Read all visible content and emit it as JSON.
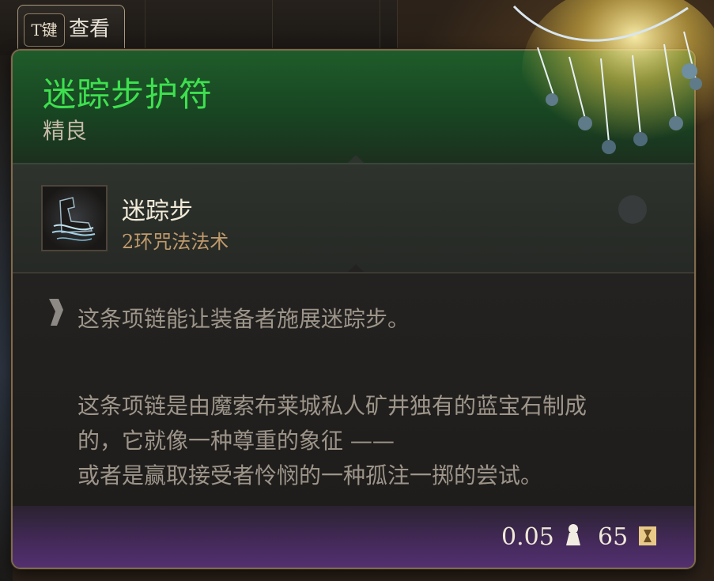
{
  "key_hint": {
    "key": "T键",
    "action": "查看"
  },
  "item": {
    "name": "迷踪步护符",
    "rarity": "精良",
    "rarity_color": "#3ee04f"
  },
  "spell": {
    "icon": "misty-step-icon",
    "name": "迷踪步",
    "level": "2环咒法法术"
  },
  "description": {
    "effect": "这条项链能让装备者施展迷踪步。",
    "lore_lines": [
      "这条项链是由魔索布莱城私人矿井独有的蓝宝石制成",
      "的，它就像一种尊重的象征 ——",
      "或者是赢取接受者怜悯的一种孤注一掷的尝试。"
    ]
  },
  "footer": {
    "weight": "0.05",
    "weight_icon": "weight-icon",
    "price": "65",
    "price_icon": "gold-coin-icon"
  }
}
